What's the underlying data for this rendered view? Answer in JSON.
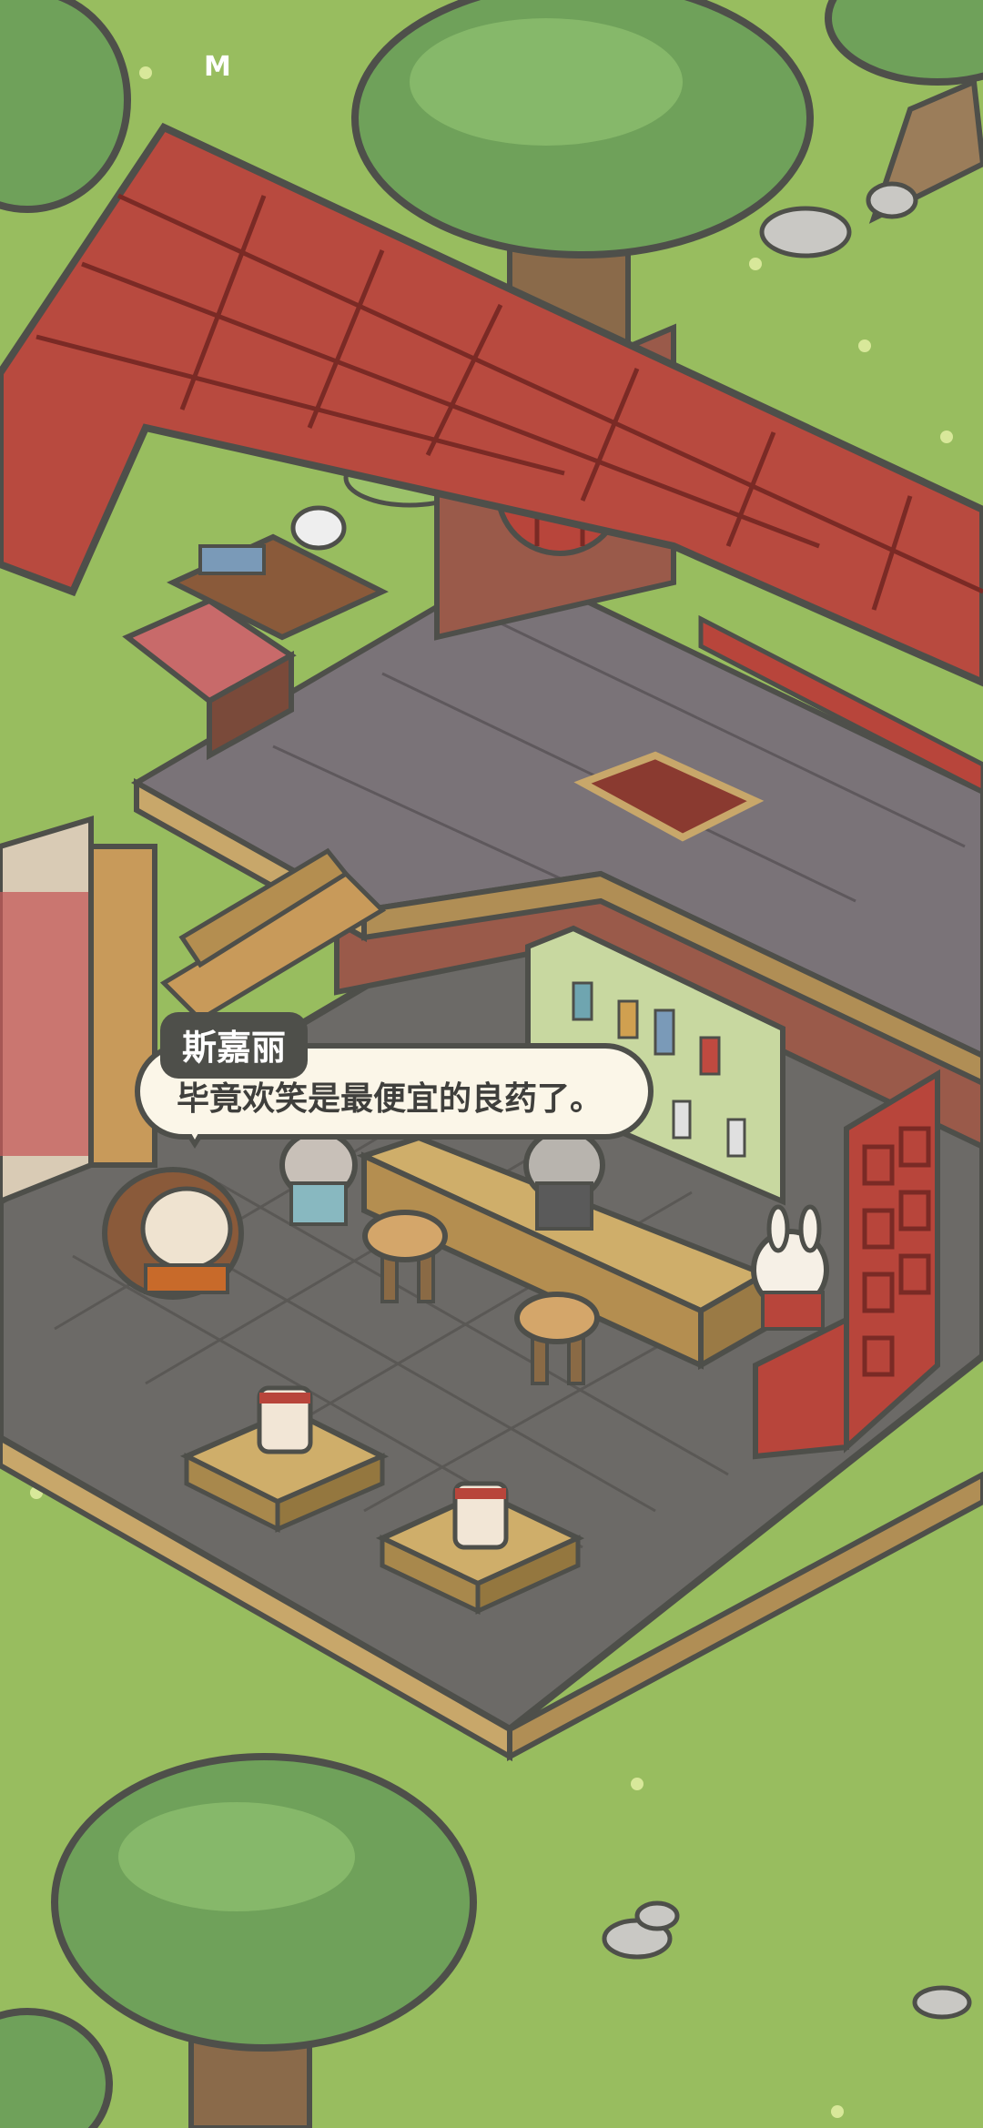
{
  "status": {
    "indicator": "M"
  },
  "dialogue": {
    "speaker": "斯嘉丽",
    "text": "毕竟欢笑是最便宜的良药了。"
  },
  "colors": {
    "grass": "#98bd5f",
    "roof": "#b84a3f",
    "floor": "#6c6a67",
    "wood": "#c89a5a",
    "brick": "#9a5a4a",
    "bubble_fill": "#fbf6e8",
    "bubble_border": "#4e4f4a"
  }
}
